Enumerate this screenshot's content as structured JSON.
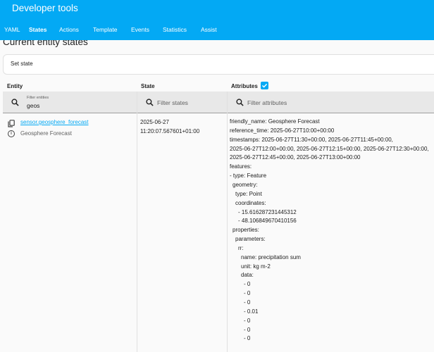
{
  "app": {
    "title": "Developer tools"
  },
  "tabs": [
    {
      "label": "YAML",
      "active": false
    },
    {
      "label": "States",
      "active": true
    },
    {
      "label": "Actions",
      "active": false
    },
    {
      "label": "Template",
      "active": false
    },
    {
      "label": "Events",
      "active": false
    },
    {
      "label": "Statistics",
      "active": false
    },
    {
      "label": "Assist",
      "active": false
    }
  ],
  "page": {
    "title": "Current entity states",
    "set_state_label": "Set state"
  },
  "columns": {
    "entity": "Entity",
    "state": "State",
    "attributes": "Attributes",
    "attributes_checked": true
  },
  "filters": {
    "entity_label": "Filter entities",
    "entity_value": "geos",
    "state_placeholder": "Filter states",
    "attributes_placeholder": "Filter attributes"
  },
  "row": {
    "entity_id": "sensor.geosphere_forecast",
    "friendly_name": "Geosphere Forecast",
    "state": "2025-06-27 11:20:07.567601+01:00",
    "attributes": [
      "friendly_name: Geosphere Forecast",
      "reference_time: 2025-06-27T10:00+00:00",
      "timestamps: 2025-06-27T11:30+00:00, 2025-06-27T11:45+00:00,",
      "2025-06-27T12:00+00:00, 2025-06-27T12:15+00:00, 2025-06-27T12:30+00:00,",
      "2025-06-27T12:45+00:00, 2025-06-27T13:00+00:00",
      "features:",
      "- type: Feature",
      "geometry:",
      "type: Point",
      "coordinates:",
      "- 15.616287231445312",
      "- 48.106849670410156",
      "properties:",
      "parameters:",
      "rr:",
      "name: precipitation sum",
      "unit: kg m-2",
      "data:",
      "- 0",
      "- 0",
      "- 0",
      "- 0.01",
      "- 0",
      "- 0",
      "- 0"
    ]
  },
  "colors": {
    "header": "#03a9f4",
    "link": "#03a9f4"
  },
  "icons": [
    "search-icon",
    "entity-copy-icon",
    "info-icon",
    "checkbox-checked-icon"
  ]
}
